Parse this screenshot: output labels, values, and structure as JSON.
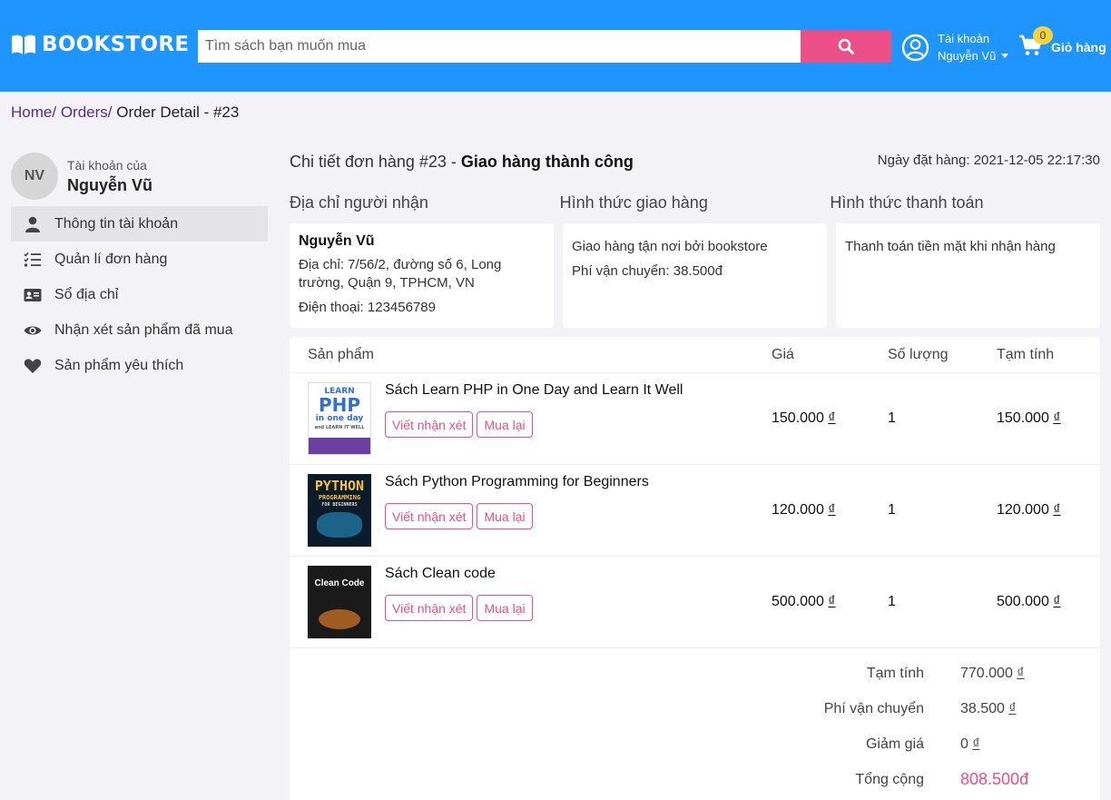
{
  "header": {
    "logo_text": "BOOKSTORE",
    "search_placeholder": "Tìm sách bạn muốn mua",
    "account_label": "Tài khoản",
    "account_name": "Nguyễn Vũ",
    "cart_count": "0",
    "cart_label": "Giỏ hàng",
    "brand_color": "#1e95ff",
    "accent_color": "#ec4e86"
  },
  "breadcrumb": {
    "home": "Home/",
    "orders": "Orders/",
    "current": "Order Detail - #23"
  },
  "sidebar": {
    "avatar_initials": "NV",
    "account_caption": "Tài khoản của",
    "user_name": "Nguyễn Vũ",
    "items": [
      {
        "label": "Thông tin tài khoản",
        "icon": "user-icon",
        "active": true
      },
      {
        "label": "Quản lí đơn hàng",
        "icon": "list-check-icon",
        "active": false
      },
      {
        "label": "Sổ địa chỉ",
        "icon": "address-card-icon",
        "active": false
      },
      {
        "label": "Nhận xét sản phẩm đã mua",
        "icon": "eye-icon",
        "active": false
      },
      {
        "label": "Sản phẩm yêu thích",
        "icon": "heart-icon",
        "active": false
      }
    ]
  },
  "order": {
    "title_prefix": "Chi tiết đơn hàng #23 - ",
    "status": "Giao hàng thành công",
    "date": "Ngày đặt hàng: 2021-12-05 22:17:30",
    "sections": {
      "address_title": "Địa chỉ người nhận",
      "shipping_title": "Hình thức giao hàng",
      "payment_title": "Hình thức thanh toán"
    },
    "address": {
      "name": "Nguyễn Vũ",
      "line": "Địa chỉ: 7/56/2, đường số 6, Long trường, Quận 9, TPHCM, VN",
      "phone": "Điện thoại: 123456789"
    },
    "shipping": {
      "method": "Giao hàng tận nơi bởi bookstore",
      "fee": "Phí vận chuyển: 38.500đ"
    },
    "payment": {
      "method": "Thanh toán tiền mặt khi nhận hàng"
    }
  },
  "table": {
    "headers": {
      "product": "Sản phẩm",
      "price": "Giá",
      "qty": "Số lượng",
      "subtotal": "Tạm tính"
    },
    "review_label": "Viết nhận xét",
    "rebuy_label": "Mua lại",
    "rows": [
      {
        "name": "Sách Learn PHP in One Day and Learn It Well",
        "price": "150.000",
        "qty": "1",
        "subtotal": "150.000",
        "cover": {
          "line1": "LEARN",
          "line2": "PHP",
          "line3": "in one day",
          "line4": "and LEARN IT WELL"
        }
      },
      {
        "name": "Sách Python Programming for Beginners",
        "price": "120.000",
        "qty": "1",
        "subtotal": "120.000",
        "cover": {
          "line1": "PYTHON",
          "line2": "PROGRAMMING",
          "line3": "FOR BEGINNERS"
        }
      },
      {
        "name": "Sách Clean code",
        "price": "500.000",
        "qty": "1",
        "subtotal": "500.000",
        "cover": {
          "line1": "Clean Code"
        }
      }
    ],
    "currency_symbol": "₫"
  },
  "totals": {
    "subtotal_label": "Tạm tính",
    "subtotal_value": "770.000",
    "shipping_label": "Phí vận chuyển",
    "shipping_value": "38.500",
    "discount_label": "Giảm giá",
    "discount_value": "0",
    "total_label": "Tổng cộng",
    "total_value": "808.500đ"
  }
}
